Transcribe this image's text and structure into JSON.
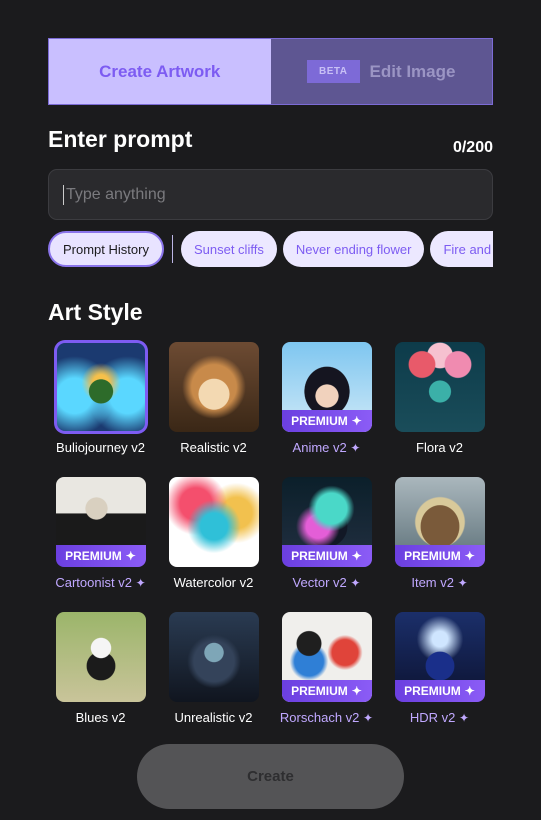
{
  "tabs": {
    "create": "Create Artwork",
    "beta": "BETA",
    "edit": "Edit Image"
  },
  "prompt": {
    "heading": "Enter prompt",
    "counter": "0/200",
    "placeholder": "Type anything"
  },
  "chips": {
    "history": "Prompt History",
    "suggestions": [
      "Sunset cliffs",
      "Never ending flower",
      "Fire and w"
    ]
  },
  "art_style": {
    "heading": "Art Style",
    "premium_label": "PREMIUM",
    "sparkle": "✦",
    "styles": [
      {
        "label": "Buliojourney v2",
        "premium": false,
        "selected": true
      },
      {
        "label": "Realistic v2",
        "premium": false
      },
      {
        "label": "Anime v2",
        "premium": true
      },
      {
        "label": "Flora v2",
        "premium": false
      },
      {
        "label": "Cartoonist v2",
        "premium": true
      },
      {
        "label": "Watercolor v2",
        "premium": false
      },
      {
        "label": "Vector v2",
        "premium": true
      },
      {
        "label": "Item v2",
        "premium": true
      },
      {
        "label": "Blues v2",
        "premium": false
      },
      {
        "label": "Unrealistic v2",
        "premium": false
      },
      {
        "label": "Rorschach v2",
        "premium": true
      },
      {
        "label": "HDR v2",
        "premium": true
      }
    ]
  },
  "create_button": "Create"
}
